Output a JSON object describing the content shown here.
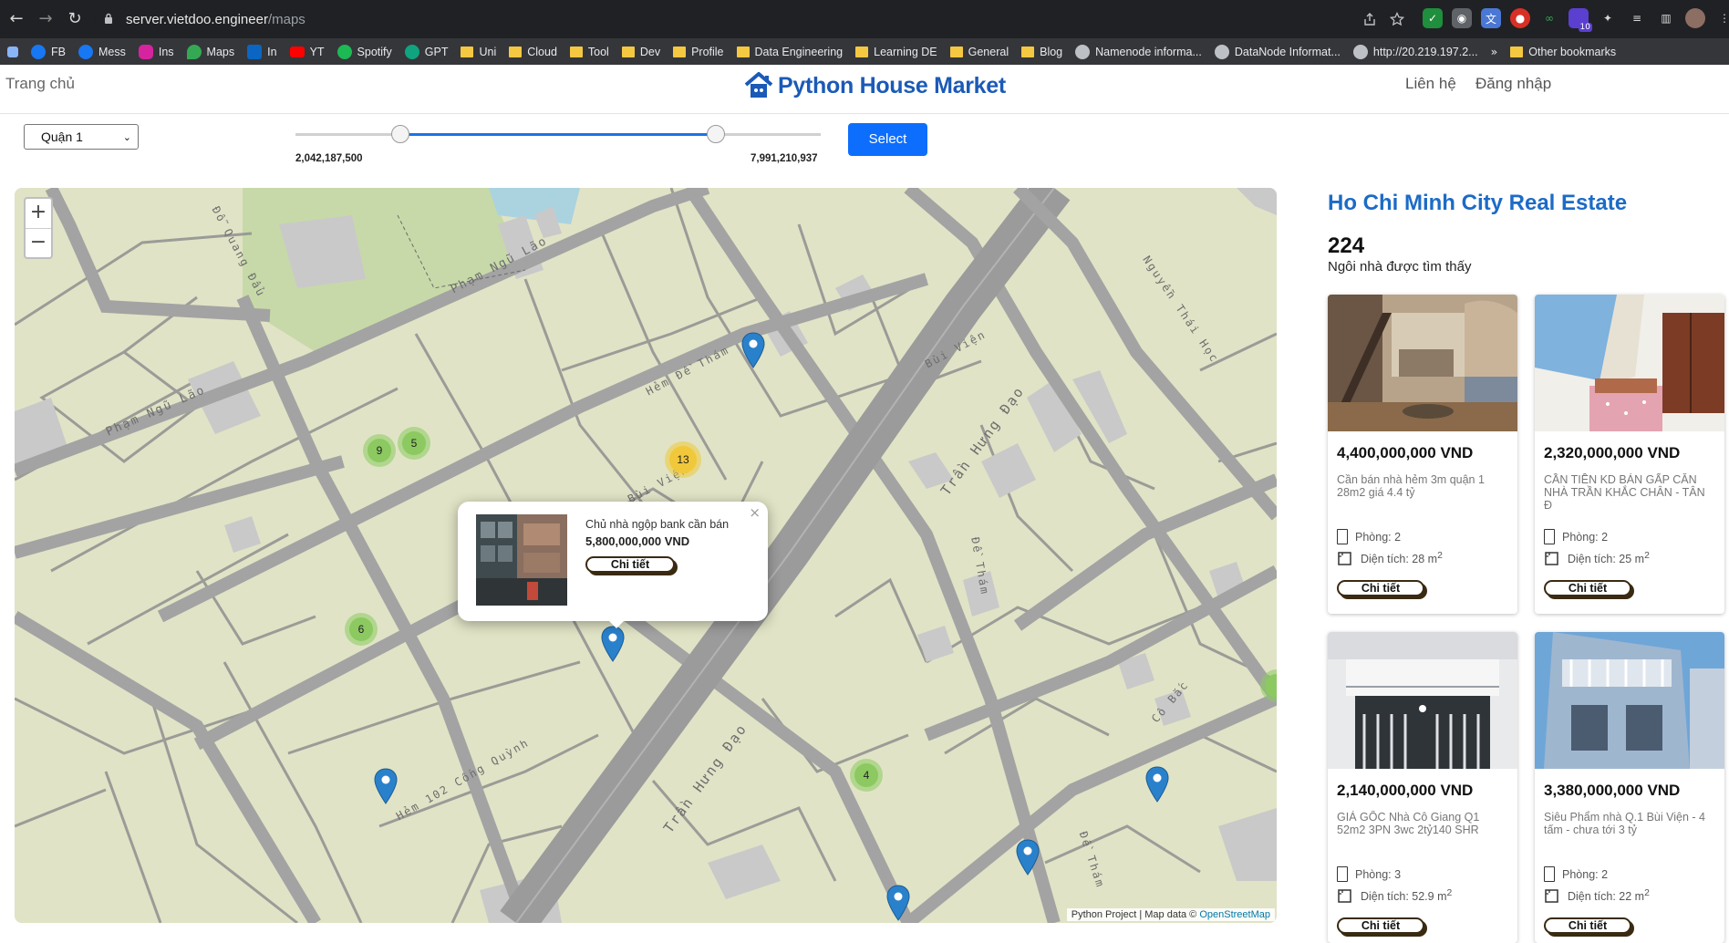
{
  "browser": {
    "url_host": "server.vietdoo.engineer",
    "url_path": "/maps",
    "bookmarks": [
      "FB",
      "Mess",
      "Ins",
      "Maps",
      "In",
      "YT",
      "Spotify",
      "GPT",
      "Uni",
      "Cloud",
      "Tool",
      "Dev",
      "Profile",
      "Data Engineering",
      "Learning DE",
      "General",
      "Blog",
      "Namenode informa...",
      "DataNode Informat...",
      "http://20.219.197.2...",
      "Other bookmarks"
    ],
    "ext_badge": "10"
  },
  "header": {
    "home": "Trang chủ",
    "brand": "Python House Market",
    "contact": "Liên hệ",
    "login": "Đăng nhập"
  },
  "filters": {
    "district": "Quận 1",
    "price_min_label": "2,042,187,500",
    "price_max_label": "7,991,210,937",
    "range_low_fraction": 0.2,
    "range_high_fraction": 0.8,
    "select_label": "Select"
  },
  "map": {
    "zoom_in": "+",
    "zoom_out": "−",
    "streets": {
      "pham_ngu_lao_top": "Phạm Ngũ Lão",
      "pham_ngu_lao_left": "Phạm Ngũ Lão",
      "do_quang_dau": "Đỗ Quang Đẩu",
      "hem_de_tham": "Hẻm Đề Thám",
      "bui_vien_top": "Bùi Viện",
      "bui_vien_mid": "Bùi Viện",
      "nguyen_thai_hoc": "Nguyễn Thái Học",
      "tran_hung_dao_top": "Trần Hưng Đạo",
      "tran_hung_dao_bottom": "Trần Hưng Đạo",
      "de_tham": "Đề Thám",
      "de_tham_bottom": "Đề Thám",
      "hem_102": "Hẻm 102 Cống Quỳnh",
      "co_bac": "Cô Bắc"
    },
    "clusters": [
      "9",
      "5",
      "13",
      "6",
      "4"
    ],
    "popup": {
      "title": "Chủ nhà ngộp bank cần bán",
      "price": "5,800,000,000 VND",
      "button": "Chi tiết",
      "close": "×"
    },
    "attribution_prefix": "Python Project | Map data © ",
    "attribution_link": "OpenStreetMap"
  },
  "panel": {
    "title": "Ho Chi Minh City Real Estate",
    "count": "224",
    "count_label": "Ngôi nhà được tìm thấy",
    "cards": [
      {
        "price": "4,400,000,000 VND",
        "desc": "Cần bán nhà hẻm 3m quận 1 28m2 giá 4.4 tỷ",
        "rooms": "Phòng: 2",
        "area": "Diện tích: 28 m",
        "button": "Chi tiết"
      },
      {
        "price": "2,320,000,000 VND",
        "desc": "CẦN TIỀN KD BÁN GẤP CĂN NHÀ TRẦN KHẮC CHÂN - TÂN Đ",
        "rooms": "Phòng: 2",
        "area": "Diện tích: 25 m",
        "button": "Chi tiết"
      },
      {
        "price": "2,140,000,000 VND",
        "desc": "GIÁ GỐC Nhà Cô Giang Q1 52m2 3PN 3wc 2tỷ140 SHR",
        "rooms": "Phòng: 3",
        "area": "Diện tích: 52.9 m",
        "button": "Chi tiết"
      },
      {
        "price": "3,380,000,000 VND",
        "desc": "Siêu Phẩm nhà Q.1 Bùi Viện - 4 tấm - chưa tới 3 tỷ",
        "rooms": "Phòng: 2",
        "area": "Diện tích: 22 m",
        "button": "Chi tiết"
      }
    ],
    "area_unit_sup": "2"
  },
  "colors": {
    "brand": "#1b5ab7",
    "panel_title": "#1c6bc7",
    "select_button": "#0d6efd",
    "map_land": "#e1e3c6",
    "map_road": "#9b9b9b",
    "pin": "#2a81cb"
  }
}
